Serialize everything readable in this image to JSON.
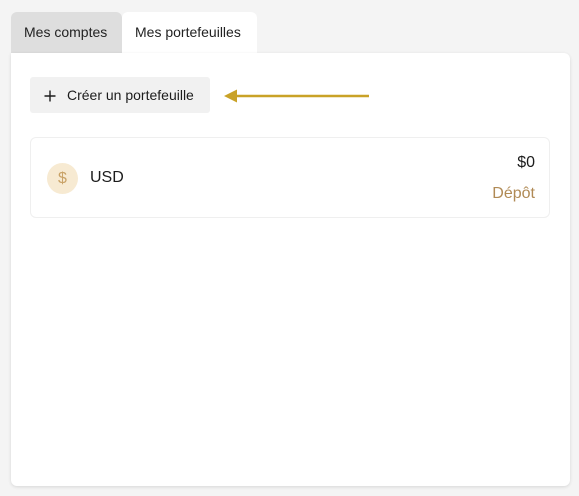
{
  "tabs": [
    {
      "label": "Mes comptes",
      "active": false
    },
    {
      "label": "Mes portefeuilles",
      "active": true
    }
  ],
  "create_button": {
    "label": "Créer un portefeuille",
    "icon": "plus-icon"
  },
  "annotation": {
    "arrow_color": "#c9a227"
  },
  "wallets": [
    {
      "currency": "USD",
      "symbol": "$",
      "balance": "$0",
      "action_label": "Dépôt"
    }
  ],
  "colors": {
    "accent": "#b08a55",
    "coin_bg": "#f7ead2",
    "coin_fg": "#c9a266",
    "inactive_tab": "#dedede",
    "background": "#f4f4f4"
  }
}
